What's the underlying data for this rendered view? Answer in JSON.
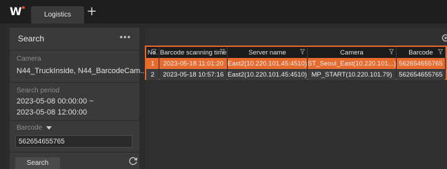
{
  "app": {
    "logo_letter": "W",
    "tab_label": "Logistics",
    "add_tab_icon": "plus-icon"
  },
  "search_panel": {
    "title": "Search",
    "more_icon": "more-icon",
    "camera_label": "Camera",
    "camera_value": "N44_TruckInside, N44_BarcodeCam...",
    "period_label": "Search period",
    "period_start": "2023-05-08 00:00:00 ~",
    "period_end": "2023-05-08 12:00:00",
    "barcode_label": "Barcode",
    "barcode_value": "562654655765",
    "search_button": "Search"
  },
  "results": {
    "columns": [
      "No.",
      "Barcode scanning time",
      "Server name",
      "Camera",
      "Barcode"
    ],
    "rows": [
      {
        "no": "1",
        "time": "2023-05-18 11:01:20",
        "server": "East2(10.220.101.45:4510)",
        "camera": "ST_Seoul_East(10.220.101...)",
        "barcode": "562654655765"
      },
      {
        "no": "2",
        "time": "2023-05-18 10:57:16",
        "server": "East2(10.220.101.45:4510)",
        "camera": "MP_START(10.220.101.79)",
        "barcode": "562654655765"
      }
    ]
  },
  "colors": {
    "accent": "#e2662d",
    "selected_row": "#e76a2e",
    "panel": "#3a3a3a",
    "background": "#2b2b2b"
  }
}
